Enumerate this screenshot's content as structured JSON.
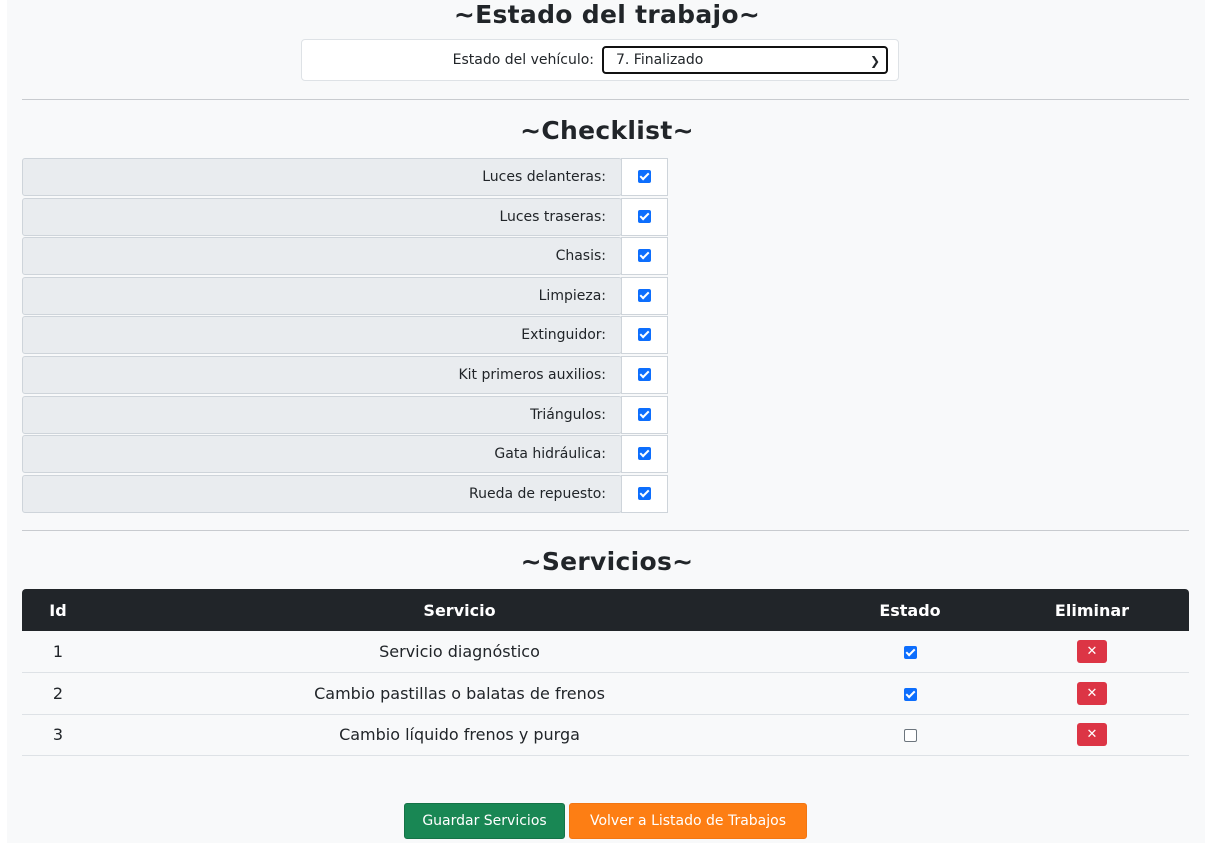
{
  "estado": {
    "title": "~Estado del trabajo~",
    "label": "Estado del vehículo:",
    "selected": "7. Finalizado"
  },
  "checklist": {
    "title": "~Checklist~",
    "items": [
      {
        "label": "Luces delanteras:",
        "checked": true
      },
      {
        "label": "Luces traseras:",
        "checked": true
      },
      {
        "label": "Chasis:",
        "checked": true
      },
      {
        "label": "Limpieza:",
        "checked": true
      },
      {
        "label": "Extinguidor:",
        "checked": true
      },
      {
        "label": "Kit primeros auxilios:",
        "checked": true
      },
      {
        "label": "Triángulos:",
        "checked": true
      },
      {
        "label": "Gata hidráulica:",
        "checked": true
      },
      {
        "label": "Rueda de repuesto:",
        "checked": true
      }
    ]
  },
  "servicios": {
    "title": "~Servicios~",
    "columns": {
      "id": "Id",
      "servicio": "Servicio",
      "estado": "Estado",
      "eliminar": "Eliminar"
    },
    "rows": [
      {
        "id": "1",
        "servicio": "Servicio diagnóstico",
        "estado": true
      },
      {
        "id": "2",
        "servicio": "Cambio pastillas o balatas de frenos",
        "estado": true
      },
      {
        "id": "3",
        "servicio": "Cambio líquido frenos y purga",
        "estado": false
      }
    ],
    "delete_glyph": "✕"
  },
  "buttons": {
    "save": "Guardar Servicios",
    "back": "Volver a Listado de Trabajos"
  },
  "colors": {
    "primary": "#0d6efd",
    "success": "#198754",
    "warning": "#fd7e14",
    "danger": "#dc3545",
    "dark": "#212529"
  }
}
